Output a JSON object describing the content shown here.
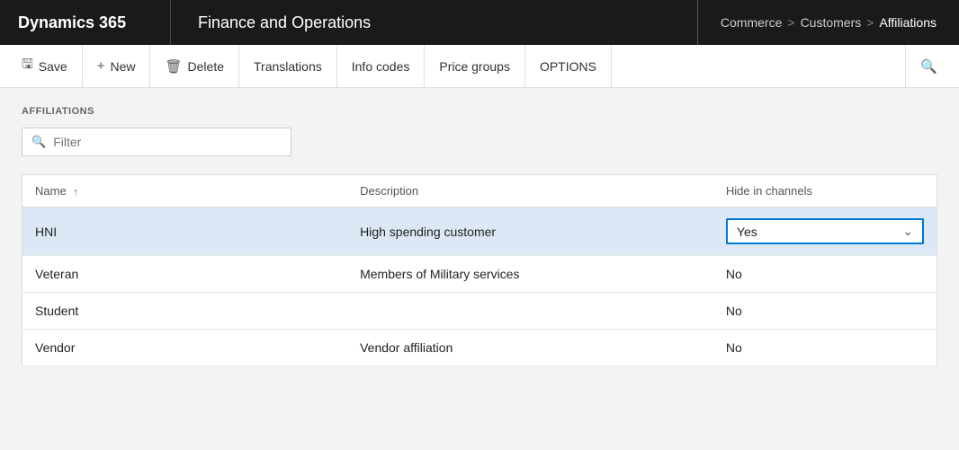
{
  "header": {
    "dynamics_label": "Dynamics 365",
    "app_label": "Finance and Operations",
    "breadcrumb": {
      "part1": "Commerce",
      "sep1": ">",
      "part2": "Customers",
      "sep2": ">",
      "part3": "Affiliations"
    }
  },
  "toolbar": {
    "save_label": "Save",
    "new_label": "New",
    "delete_label": "Delete",
    "translations_label": "Translations",
    "info_codes_label": "Info codes",
    "price_groups_label": "Price groups",
    "options_label": "OPTIONS",
    "save_icon": "💾",
    "new_icon": "+",
    "delete_icon": "🗑",
    "search_icon": "🔍"
  },
  "section": {
    "title": "AFFILIATIONS"
  },
  "filter": {
    "placeholder": "Filter"
  },
  "table": {
    "columns": [
      {
        "key": "name",
        "label": "Name",
        "sortable": true,
        "sort_dir": "asc"
      },
      {
        "key": "description",
        "label": "Description",
        "sortable": false
      },
      {
        "key": "hide_in_channels",
        "label": "Hide in channels",
        "sortable": false
      }
    ],
    "rows": [
      {
        "id": 1,
        "name": "HNI",
        "description": "High spending customer",
        "hide_in_channels": "Yes",
        "selected": true,
        "dropdown_open": true
      },
      {
        "id": 2,
        "name": "Veteran",
        "description": "Members of Military services",
        "hide_in_channels": "No",
        "selected": false,
        "dropdown_open": false
      },
      {
        "id": 3,
        "name": "Student",
        "description": "",
        "hide_in_channels": "No",
        "selected": false,
        "dropdown_open": false
      },
      {
        "id": 4,
        "name": "Vendor",
        "description": "Vendor affiliation",
        "hide_in_channels": "No",
        "selected": false,
        "dropdown_open": false
      }
    ]
  }
}
